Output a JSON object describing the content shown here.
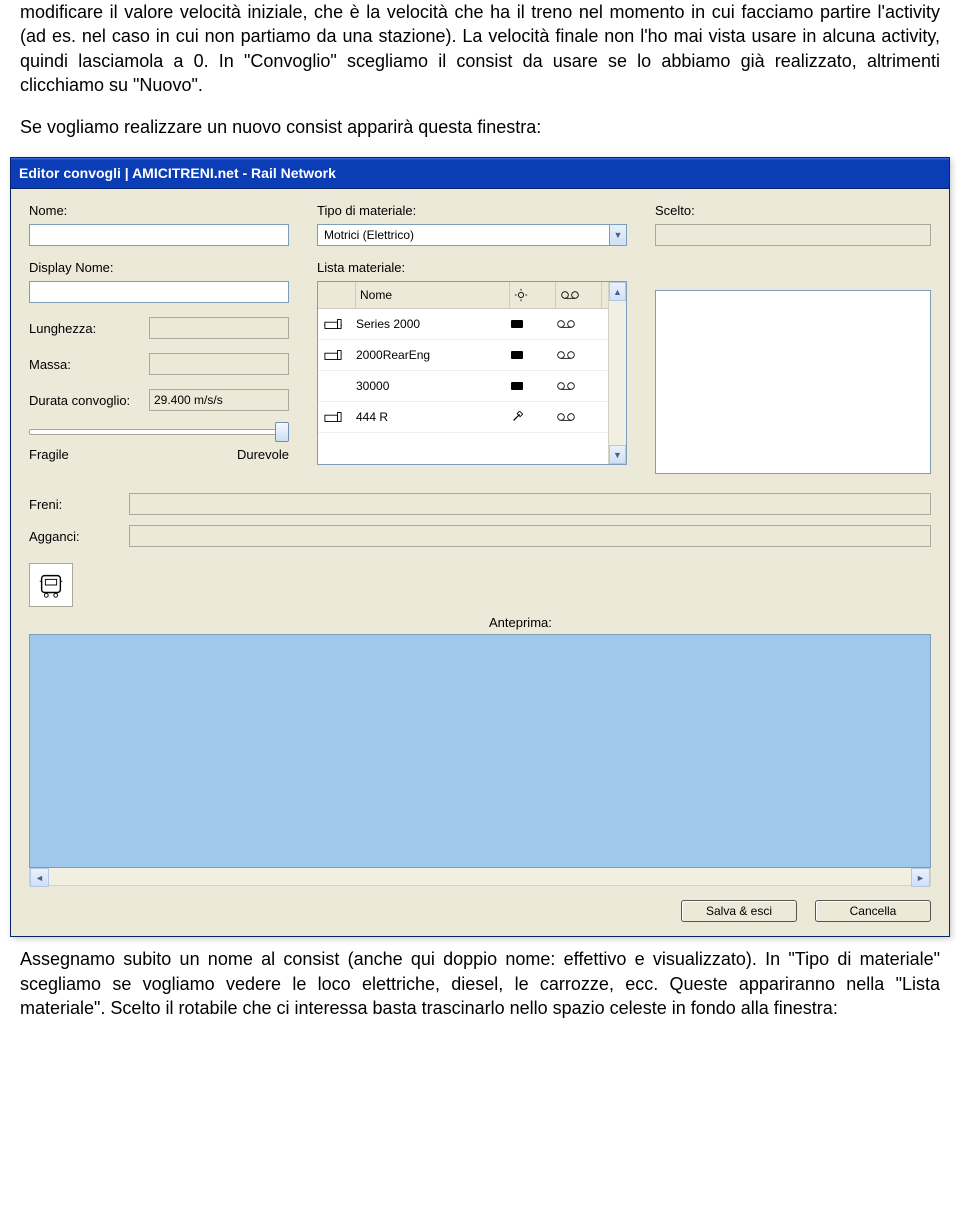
{
  "doc": {
    "p1": "modificare il valore velocità iniziale, che è la velocità che ha il treno nel momento in cui facciamo partire l'activity (ad es. nel caso in cui non partiamo da una stazione). La velocità finale non l'ho mai vista usare in alcuna activity, quindi lasciamola a 0. In \"Convoglio\" scegliamo il consist da usare se lo abbiamo già realizzato, altrimenti clicchiamo su \"Nuovo\".",
    "p2": "Se vogliamo realizzare un nuovo consist apparirà questa finestra:",
    "p3": "Assegnamo subito un nome al consist (anche qui doppio nome: effettivo e visualizzato). In \"Tipo di materiale\" scegliamo se vogliamo vedere le loco elettriche, diesel, le carrozze, ecc. Queste appariranno nella \"Lista materiale\". Scelto il rotabile che ci interessa basta trascinarlo nello spazio celeste in fondo alla finestra:"
  },
  "win": {
    "title": "Editor convogli | AMICITRENI.net - Rail Network",
    "labels": {
      "nome": "Nome:",
      "tipo": "Tipo di materiale:",
      "scelto": "Scelto:",
      "display_nome": "Display Nome:",
      "lista": "Lista materiale:",
      "lunghezza": "Lunghezza:",
      "massa": "Massa:",
      "durata": "Durata convoglio:",
      "fragile": "Fragile",
      "durevole": "Durevole",
      "freni": "Freni:",
      "agganci": "Agganci:",
      "anteprima": "Anteprima:"
    },
    "values": {
      "nome": "",
      "display_nome": "",
      "lunghezza": "",
      "massa": "",
      "durata": "29.400 m/s/s",
      "tipo_selected": "Motrici (Elettrico)",
      "scelto": "",
      "freni": "",
      "agganci": ""
    },
    "list_header": {
      "col_nome": "Nome"
    },
    "list_rows": [
      {
        "name": "Series 2000",
        "engine": true,
        "tape": true
      },
      {
        "name": "2000RearEng",
        "engine": true,
        "tape": true
      },
      {
        "name": "30000",
        "engine": false,
        "tape": true
      },
      {
        "name": "444 R",
        "engine": true,
        "tape": true
      }
    ],
    "buttons": {
      "save": "Salva & esci",
      "cancel": "Cancella"
    }
  }
}
